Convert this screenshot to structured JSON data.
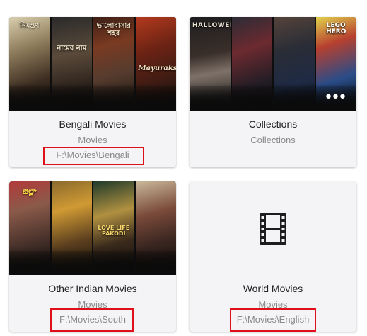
{
  "libraries": [
    {
      "title": "Bengali Movies",
      "type": "Movies",
      "path": "F:\\Movies\\Bengali",
      "poster_texts": [
        "নিমন্ত্রণ",
        "নামের নাম",
        "ভালোবাসার শহর",
        "Mayurakshi"
      ]
    },
    {
      "title": "Collections",
      "type": "Collections",
      "path": "",
      "poster_texts": [
        "HALLOWEEN",
        "",
        "",
        "LEGO HERO"
      ],
      "more_icon": "more-horizontal-icon"
    },
    {
      "title": "Other Indian Movies",
      "type": "Movies",
      "path": "F:\\Movies\\South",
      "poster_texts": [
        "జిల్లా",
        "",
        "LOVE LIFE PAKODI",
        ""
      ]
    },
    {
      "title": "World Movies",
      "type": "Movies",
      "path": "F:\\Movies\\English",
      "placeholder_icon": "film-strip-icon"
    }
  ],
  "colors": {
    "card_background": "#f4f4f6",
    "highlight_border": "#e0101a",
    "title_text": "#1f1f1f",
    "secondary_text": "#8a8a8a"
  }
}
